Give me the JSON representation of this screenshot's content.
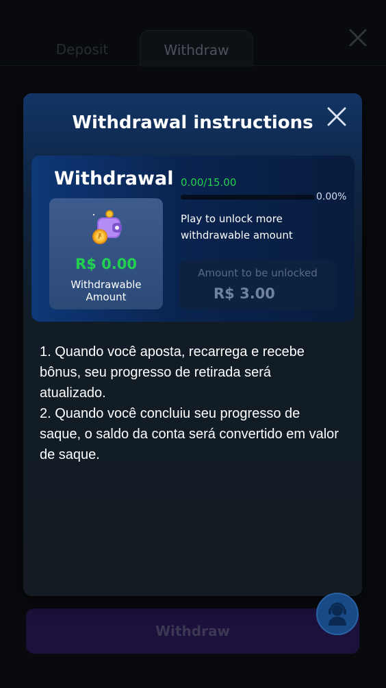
{
  "tabs": {
    "deposit": "Deposit",
    "withdraw": "Withdraw"
  },
  "bottom_button": {
    "label": "Withdraw"
  },
  "modal": {
    "title": "Withdrawal instructions",
    "card": {
      "title": "Withdrawal",
      "available_amount": "R$ 0.00",
      "available_label": "Withdrawable Amount",
      "progress_text": "0.00/15.00",
      "progress_percent_label": "0.00%",
      "progress_fraction": 0.0,
      "unlock_message": "Play to unlock more withdrawable amount",
      "locked_label": "Amount to be unlocked",
      "locked_amount": "R$ 3.00"
    },
    "instructions": [
      "1. Quando você aposta, recarrega e recebe bônus, seu progresso de retirada será atualizado.",
      "2. Quando você concluiu seu progresso de saque, o saldo da conta será convertido em valor de saque."
    ]
  },
  "colors": {
    "accent_green": "#22d14f",
    "brand_purple": "#2c1a5c",
    "support_blue": "#174a86"
  },
  "icons": [
    "close-icon",
    "wallet-icon",
    "support-agent-icon"
  ]
}
